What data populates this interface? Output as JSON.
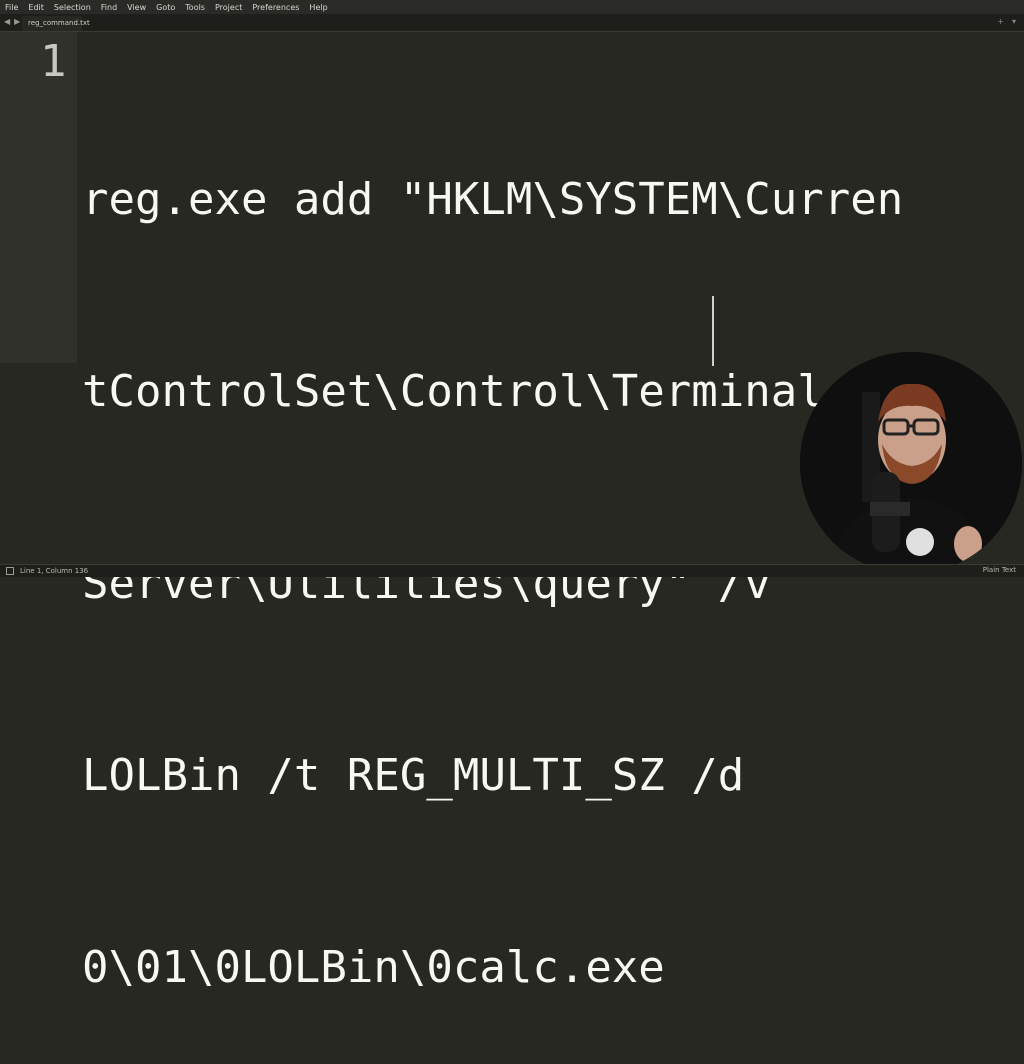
{
  "menubar": {
    "items": [
      "File",
      "Edit",
      "Selection",
      "Find",
      "View",
      "Goto",
      "Tools",
      "Project",
      "Preferences",
      "Help"
    ]
  },
  "tabs": {
    "active": "reg_command.txt"
  },
  "editor": {
    "line_number": "1",
    "lines": [
      "reg.exe add \"HKLM\\SYSTEM\\Curren",
      "tControlSet\\Control\\Terminal",
      "Server\\Utilities\\query\" /v",
      "LOLBin /t REG_MULTI_SZ /d",
      "0\\01\\0LOLBin\\0calc.exe"
    ]
  },
  "statusbar": {
    "position": "Line 1, Column 136",
    "syntax": "Plain Text"
  }
}
